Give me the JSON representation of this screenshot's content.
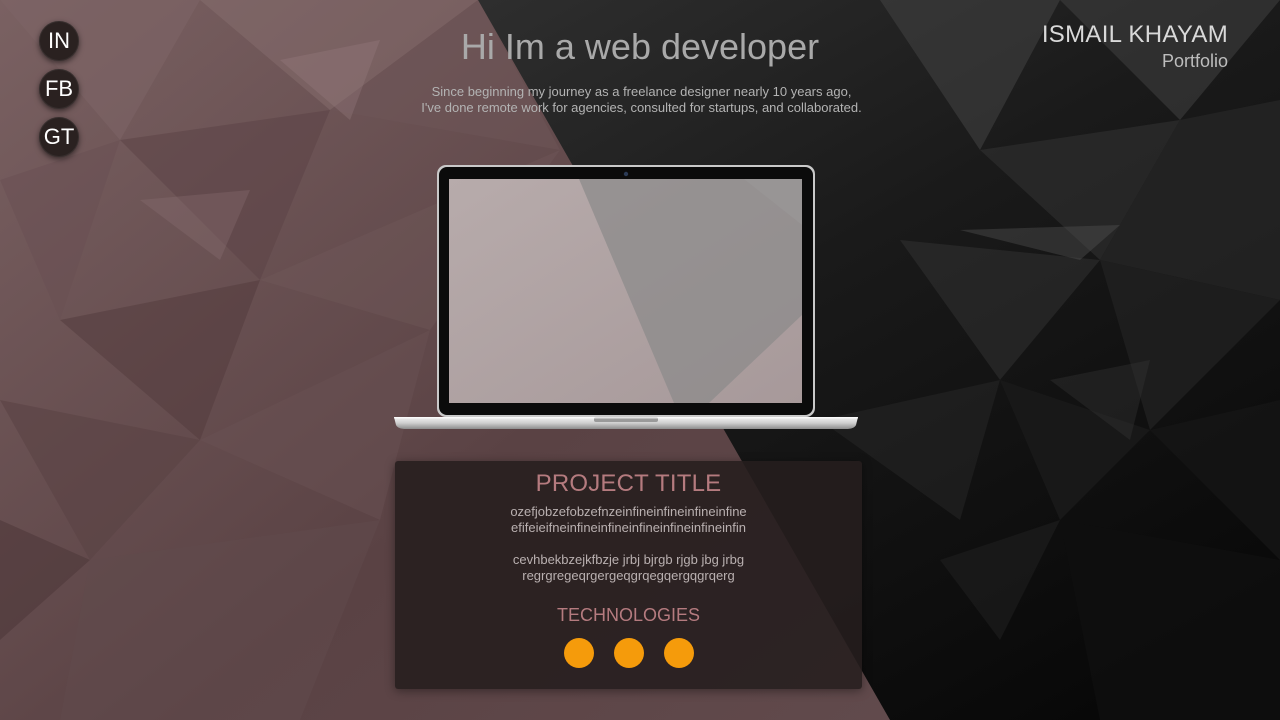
{
  "social": {
    "items": [
      {
        "label": "IN",
        "name": "linkedin-button"
      },
      {
        "label": "FB",
        "name": "facebook-button"
      },
      {
        "label": "GT",
        "name": "github-button"
      }
    ]
  },
  "brand": {
    "name": "ISMAIL KHAYAM",
    "subtitle": "Portfolio"
  },
  "hero": {
    "title": "Hi Im a web developer",
    "lines": [
      "Since beginning my journey as a freelance designer nearly 10 years ago,",
      "I've done remote work for agencies, consulted for startups, and collaborated."
    ]
  },
  "project": {
    "title": "PROJECT TITLE",
    "paragraph1": [
      "ozefjobzefobzefnzeinfineinfineinfineinfine",
      "efifeieifneinfineinfineinfineinfineinfineinfin"
    ],
    "paragraph2": [
      "cevhbekbzejkfbzje jrbj  bjrgb rjgb jbg jrbg",
      "regrgregeqrgergeqgrqegqergqgrqerg"
    ],
    "technologies_label": "TECHNOLOGIES",
    "technologies": [
      {
        "name": "technology-1"
      },
      {
        "name": "technology-2"
      },
      {
        "name": "technology-3"
      }
    ]
  },
  "colors": {
    "accent": "#f59b0b",
    "title_pink": "#b57b7f",
    "bg_left": "#5e4648",
    "bg_right": "#0d0d0d",
    "card_bg": "#261e1e"
  }
}
